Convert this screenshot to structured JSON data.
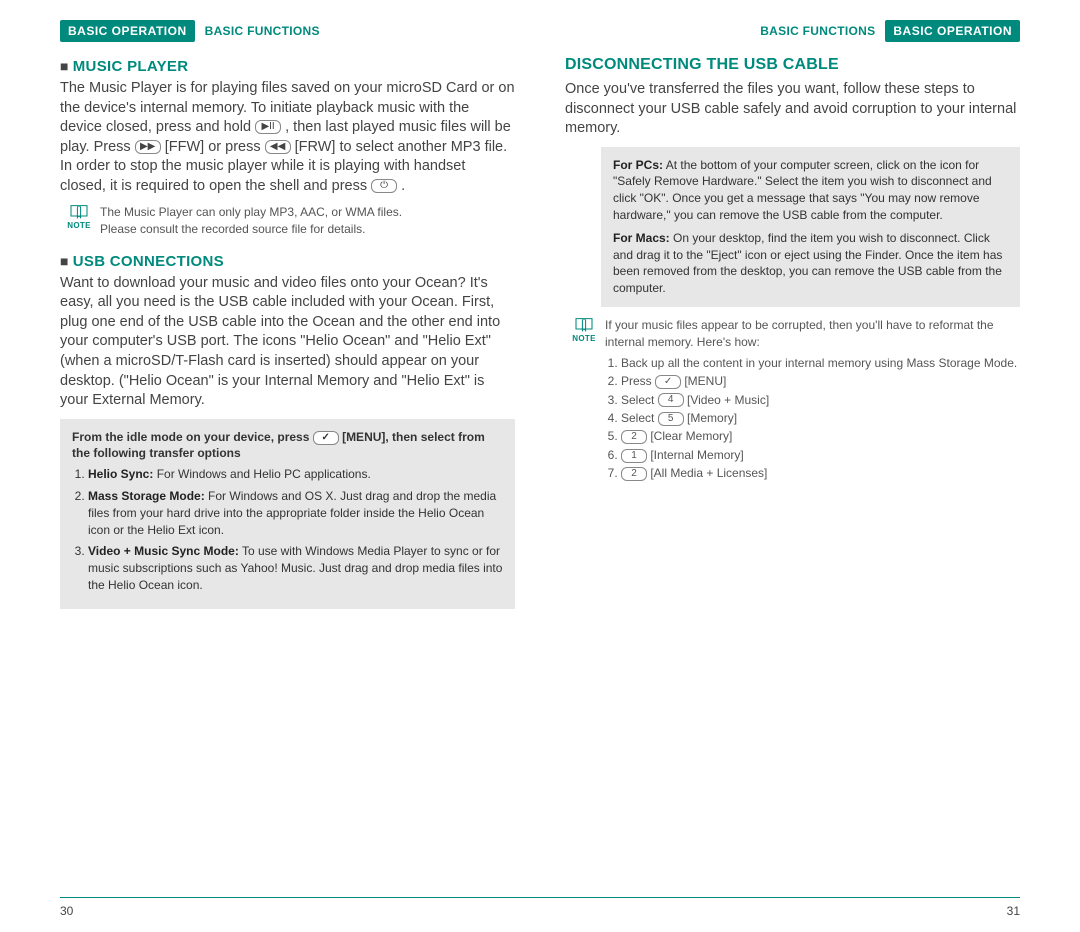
{
  "left": {
    "badge": "BASIC OPERATION",
    "crumb": "BASIC FUNCTIONS",
    "section1_title": "MUSIC PLAYER",
    "section1_body_a": "The Music Player is for playing files saved on your microSD Card or on the device's internal memory. To initiate playback music with the device closed, press and hold ",
    "section1_body_b": " , then last played music files will be play. Press ",
    "section1_body_c": " [FFW] or press ",
    "section1_body_d": " [FRW] to select another MP3 file. In order to stop the music player while it is playing with handset closed, it is required to open the shell and press ",
    "section1_body_e": " .",
    "note1_l1": "The Music Player can only play MP3, AAC, or WMA files.",
    "note1_l2": "Please consult the recorded source file for details.",
    "section2_title": "USB CONNECTIONS",
    "section2_body": "Want to download your music and video files onto your Ocean? It's easy, all you need is the USB cable included with your Ocean. First, plug one end of the USB cable into the Ocean and the other end into your computer's USB port. The icons \"Helio Ocean\" and \"Helio Ext\" (when a microSD/T-Flash card is inserted) should appear on your desktop. (\"Helio Ocean\" is your Internal Memory and \"Helio Ext\" is your External Memory.",
    "grey1_lead_a": "From the idle mode on your device, press ",
    "grey1_lead_b": " [MENU], then select from the following transfer options",
    "grey1_item1_t": "Helio Sync:",
    "grey1_item1_b": " For Windows and Helio PC applications.",
    "grey1_item2_t": "Mass Storage Mode:",
    "grey1_item2_b": " For Windows and OS X. Just drag and drop the media files from your hard drive into the appropriate folder inside the Helio Ocean icon or the Helio Ext icon.",
    "grey1_item3_t": "Video + Music Sync Mode:",
    "grey1_item3_b": " To use with Windows Media Player to sync or for music subscriptions such as Yahoo! Music. Just drag and drop media files into the Helio Ocean icon.",
    "pagenum": "30"
  },
  "right": {
    "crumb": "BASIC FUNCTIONS",
    "badge": "BASIC OPERATION",
    "title": "DISCONNECTING THE USB CABLE",
    "body": "Once you've transferred the files you want, follow these steps to disconnect your USB cable safely and avoid corruption to your internal memory.",
    "grey_pc_t": "For PCs:",
    "grey_pc_b": " At the bottom of your computer screen, click on the icon for \"Safely Remove Hardware.\" Select the item you wish to disconnect and click \"OK\". Once you get a message that says \"You may now remove hardware,\" you can remove the USB cable from the computer.",
    "grey_mac_t": "For Macs:",
    "grey_mac_b": " On your desktop, find the item you wish to disconnect. Click and drag it to the \"Eject\" icon or eject using the Finder. Once the item has been removed from the desktop, you can remove the USB cable from the computer.",
    "note_intro": "If your music files appear to be corrupted, then you'll have to reformat the internal memory. Here's how:",
    "steps": {
      "s1": "Back up all the content in your internal memory using Mass Storage Mode.",
      "s2a": "Press ",
      "s2b": " [MENU]",
      "s3a": "Select ",
      "s3b": " [Video + Music]",
      "s4a": "Select ",
      "s4b": " [Memory]",
      "s5b": " [Clear Memory]",
      "s6b": " [Internal Memory]",
      "s7b": " [All Media + Licenses]"
    },
    "keys": {
      "k2": "✓",
      "k3": "4",
      "k4": "5",
      "k5": "2",
      "k6": "1",
      "k7": "2"
    },
    "pagenum": "31"
  },
  "note_label": "NOTE"
}
